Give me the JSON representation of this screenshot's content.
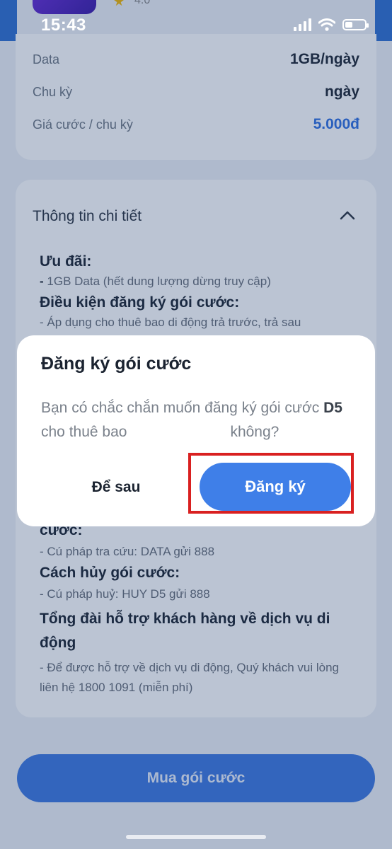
{
  "status_bar": {
    "time": "15:43"
  },
  "app_header": {
    "rating": "4.0"
  },
  "summary": {
    "rows": [
      {
        "label": "Data",
        "value": "1GB/ngày"
      },
      {
        "label": "Chu kỳ",
        "value": "ngày"
      },
      {
        "label": "Giá cước / chu kỳ",
        "value": "5.000đ"
      }
    ]
  },
  "details": {
    "title": "Thông tin chi tiết",
    "sections": {
      "offers_heading": "Ưu đãi:",
      "offers_text": "1GB Data (hết dung lượng dừng truy cập)",
      "conditions_heading": "Điều kiện đăng ký gói cước:",
      "conditions_text": "- Áp dụng cho thuê bao di động trả trước, trả sau",
      "check_heading_tail": "cước:",
      "check_text": "- Cú pháp tra cứu: DATA gửi 888",
      "cancel_heading": "Cách hủy gói cước:",
      "cancel_text": "- Cú pháp huỷ: HUY D5 gửi 888",
      "hotline_heading": "Tổng đài hỗ trợ khách hàng về dịch vụ di động",
      "hotline_text": "- Để được hỗ trợ về dịch vụ di động, Quý khách vui lòng liên hệ 1800 1091 (miễn phí)"
    }
  },
  "buy_button": {
    "label": "Mua gói cước"
  },
  "dialog": {
    "title": "Đăng ký gói cước",
    "message_part1": "Bạn có chắc chắn muốn đăng ký gói cước ",
    "package": "D5",
    "message_part2": " cho thuê bao",
    "message_part3": "không?",
    "later_label": "Để sau",
    "register_label": "Đăng ký"
  }
}
